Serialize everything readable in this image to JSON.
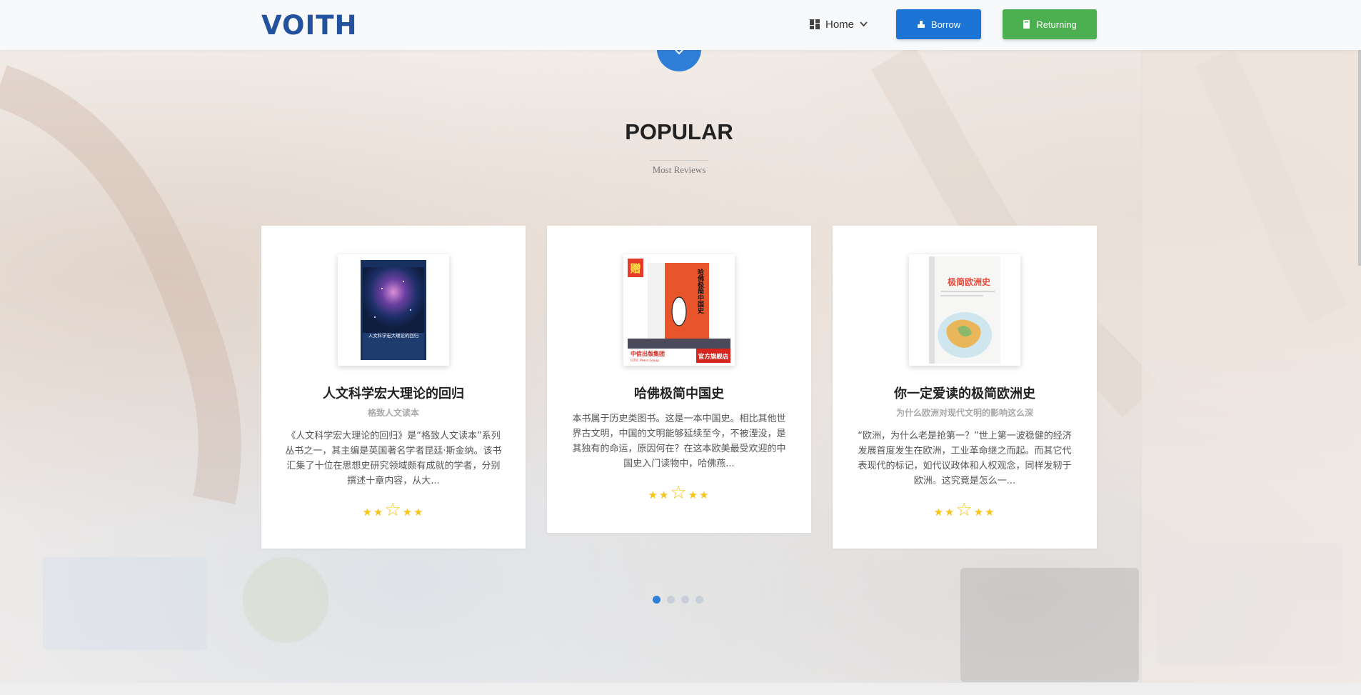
{
  "header": {
    "logo": "VOITH",
    "nav_home": "Home",
    "borrow_label": "Borrow",
    "returning_label": "Returning"
  },
  "section": {
    "title": "POPULAR",
    "subtitle": "Most Reviews"
  },
  "cards": [
    {
      "title": "人文科学宏大理论的回归",
      "subtitle": "格致人文读本",
      "desc": "《人文科学宏大理论的回归》是“格致人文读本”系列丛书之一，其主编是英国著名学者昆廷·斯金纳。该书汇集了十位在思想史研究领域颇有成就的学者，分别撰述十章内容，从大...",
      "rating": 5,
      "cover_title": "人文科学宏大理论的回归",
      "cover_color": "#1e3c6e"
    },
    {
      "title": "哈佛极简中国史",
      "subtitle": "",
      "desc": "本书属于历史类图书。这是一本中国史。相比其他世界古文明，中国的文明能够延续至今，不被湮没，是其独有的命运，原因何在？在这本欧美最受欢迎的中国史入门读物中，哈佛燕...",
      "rating": 5,
      "cover_badge": "赠",
      "cover_title": "哈佛极简中国史",
      "cover_footer_brand": "中信出版集团",
      "cover_footer_brand_en": "CITIC Press Group",
      "cover_footer_store": "官方旗舰店",
      "cover_color": "#e8552a"
    },
    {
      "title": "你一定爱读的极简欧洲史",
      "subtitle": "为什么欧洲对现代文明的影响这么深",
      "desc": "“欧洲，为什么老是抢第一？”世上第一波稳健的经济发展首度发生在欧洲，工业革命继之而起。而其它代表现代的标记，如代议政体和人权观念，同样发轫于欧洲。这究竟是怎么一...",
      "rating": 5,
      "cover_title": "极简欧洲史",
      "cover_color": "#e94c3c"
    }
  ],
  "carousel": {
    "pages": 4,
    "active": 1
  },
  "colors": {
    "brand": "#23539f",
    "borrow": "#1c74d6",
    "returning": "#4caf50",
    "star": "#f5c518"
  }
}
